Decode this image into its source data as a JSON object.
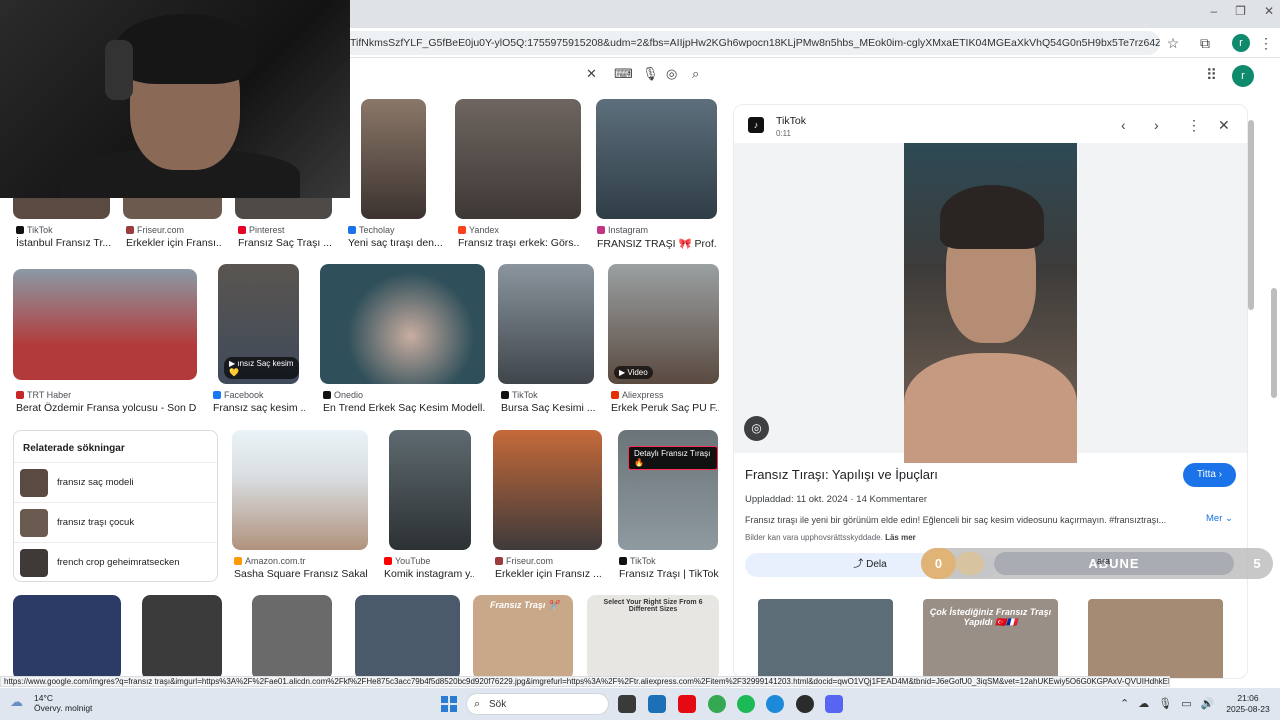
{
  "browser": {
    "window_controls": [
      "–",
      "❐",
      "✕"
    ],
    "url": "TifNkmsSzfYLF_G5fBeE0ju0Y-ylO5Q:1755975915208&udm=2&fbs=AIIjpHw2KGh6wpocn18KLjPMw8n5hbs_MEok0im-cglyXMxaETIK04MGEaXkVhQ54G0n5H9bx5Te7rz64Ziwgy75wwdxMLULm0As...",
    "profile_initial": "r",
    "toolbar_icons": [
      "star-icon",
      "extensions-icon",
      "menu-icon"
    ]
  },
  "search": {
    "icons": [
      "clear-icon",
      "keyboard-icon",
      "mic-icon",
      "lens-icon",
      "search-icon"
    ],
    "account_initial": "r"
  },
  "grid": {
    "row1": [
      {
        "source": "TikTok",
        "title": "İstanbul Fransız Tr...",
        "color": "#5a4a42",
        "favicon": "#111111"
      },
      {
        "source": "Friseur.com",
        "title": "Erkekler için Fransı...",
        "color": "#6d5a4e",
        "favicon": "#9b3b3b"
      },
      {
        "source": "Pinterest",
        "title": "Fransız Saç Traşı ...",
        "color": "#4d4a48",
        "favicon": "#e60023"
      },
      {
        "source": "Techolay",
        "title": "Yeni saç tıraşı den...",
        "color": "#6e5b4f",
        "favicon": "#1a73e8"
      },
      {
        "source": "Yandex",
        "title": "Fransız traşı erkek: Görs...",
        "color": "#5a524d",
        "favicon": "#fc3f1d"
      },
      {
        "source": "Instagram",
        "title": "FRANSIZ TRAŞI 🎀 Prof...",
        "color": "#4b5d6a",
        "favicon": "#c13584"
      }
    ],
    "row2": [
      {
        "source": "TRT Haber",
        "title": "Berat Özdemir Fransa yolcusu - Son D...",
        "color": "#b33a3a",
        "favicon": "#c62828"
      },
      {
        "source": "Facebook",
        "title": "Fransız saç kesim ...",
        "color": "#3f4a5a",
        "favicon": "#1877f2",
        "badge": "▶ ınsız Saç kesim 💛"
      },
      {
        "source": "Onedio",
        "title": "En Trend Erkek Saç Kesim Modell...",
        "color": "#2f4f5a",
        "favicon": "#111111"
      },
      {
        "source": "TikTok",
        "title": "Bursa Saç Kesimi ...",
        "color": "#5c6670",
        "favicon": "#111111"
      },
      {
        "source": "Aliexpress",
        "title": "Erkek Peruk Saç PU F...",
        "color": "#7c7f80",
        "favicon": "#e62e04",
        "badge": "▶ Video"
      }
    ],
    "row3": [
      {
        "source": "Amazon.com.tr",
        "title": "Sasha Square Fransız Sakal...",
        "color": "#d9dde0",
        "favicon": "#ff9900"
      },
      {
        "source": "YouTube",
        "title": "Komik instagram y...",
        "color": "#3e4446",
        "favicon": "#ff0000"
      },
      {
        "source": "Friseur.com",
        "title": "Erkekler için Fransız ...",
        "color": "#b0623e",
        "favicon": "#9b3b3b"
      },
      {
        "source": "TikTok",
        "title": "Fransız Traşı | TikTok",
        "color": "#7f8a90",
        "favicon": "#111111",
        "badge": "Detaylı Fransız Tıraşı 🔥"
      }
    ],
    "row4": [
      {
        "color": "#2c3a66"
      },
      {
        "color": "#3b3b3b"
      },
      {
        "color": "#6a6a6a"
      },
      {
        "color": "#4a5a6a"
      },
      {
        "color": "#c9a88a",
        "badge": "Fransız Traşı ✂️"
      },
      {
        "color": "#e8e6e2",
        "badge": "Select Your Right Size From 6 Different Sizes"
      }
    ]
  },
  "related": {
    "heading": "Relaterade sökningar",
    "items": [
      {
        "label": "fransız saç modeli",
        "color": "#5a4a42"
      },
      {
        "label": "fransız traşı çocuk",
        "color": "#6b5a50"
      },
      {
        "label": "french crop geheimratsecken",
        "color": "#3f3a38"
      }
    ]
  },
  "panel": {
    "source": "TikTok",
    "duration": "0:11",
    "title": "Fransız Tıraşı: Yapılışı ve İpuçları",
    "visit_label": "Titta",
    "uploaded": "Uppladdad: 11 okt. 2024",
    "comments": "14 Kommentarer",
    "description": "Fransız tıraşı ile yeni bir görünüm elde edin! Eğlenceli bir saç kesim videosunu kaçırmayın. #fransıztraşı...",
    "more_label": "Mer",
    "copyright": "Bilder kan vara upphovsrättsskyddade.",
    "read_more": "Läs mer",
    "share_label": "Dela",
    "save_label": "ara",
    "related_images": [
      {
        "color": "#5d6d78"
      },
      {
        "color": "#9a8f86",
        "caption": "Çok İstediğiniz Fransız Traşı Yapıldı 🇹🇷🇫🇷"
      },
      {
        "color": "#a58a74"
      }
    ]
  },
  "overlay": {
    "left_count": "0",
    "label": "ABUNE",
    "right_count": "5"
  },
  "statusbar": {
    "url": "https://www.google.com/imgres?q=fransız traşı&imgurl=https%3A%2F%2Fae01.alicdn.com%2Fkf%2FHe875c3acc79b4f5d8520bc9d920f76229.jpg&imgrefurl=https%3A%2F%2Ftr.aliexpress.com%2Fitem%2F32999141203.html&docid=qwO1VQj1FEAD4M&tbnid=J6eGofU0_3iqSM&vet=12ahUKEwiy5O6G0KGPAxV-QVUIHdhkEkQQM3oECF0QAA..i&w=100..."
  },
  "taskbar": {
    "temperature": "14°C",
    "weather": "Övervy. molnigt",
    "search_placeholder": "Sök",
    "time": "21:06",
    "date": "2025-08-23"
  }
}
